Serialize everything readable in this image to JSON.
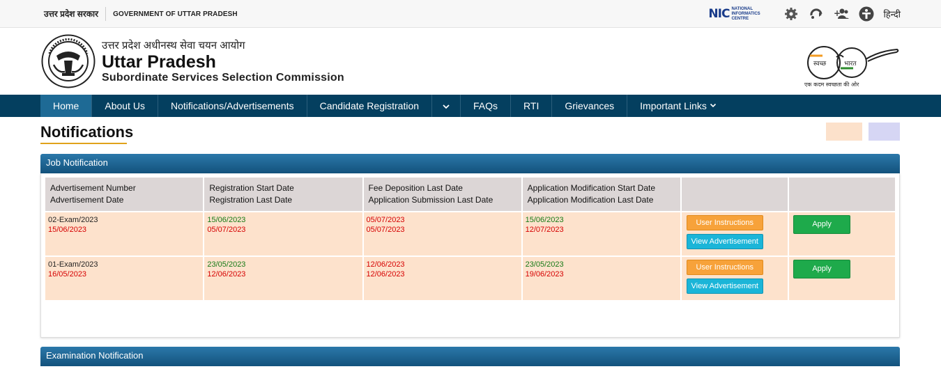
{
  "topbar": {
    "gov_hindi": "उत्तर प्रदेश सरकार",
    "gov_english": "GOVERNMENT OF UTTAR PRADESH",
    "nic_mark": "NIC",
    "nic_text": "NATIONAL INFORMATICS CENTRE",
    "language": "हिन्दी"
  },
  "header": {
    "title_hindi": "उत्तर प्रदेश अधीनस्थ सेवा चयन आयोग",
    "title_main": "Uttar Pradesh",
    "title_sub": "Subordinate Services Selection Commission",
    "swachh_left": "स्वच्छ",
    "swachh_right": "भारत",
    "swachh_tagline": "एक कदम स्वच्छता की ओर"
  },
  "nav": {
    "items": [
      {
        "label": "Home",
        "active": true
      },
      {
        "label": "About Us"
      },
      {
        "label": "Notifications/Advertisements"
      },
      {
        "label": "Candidate Registration"
      },
      {
        "label": ""
      },
      {
        "label": "FAQs"
      },
      {
        "label": "RTI"
      },
      {
        "label": "Grievances"
      },
      {
        "label": "Important Links"
      }
    ]
  },
  "page": {
    "title": "Notifications"
  },
  "job_panel": {
    "title": "Job Notification",
    "headers": [
      [
        "Advertisement Number",
        "Advertisement Date"
      ],
      [
        "Registration Start Date",
        "Registration Last Date"
      ],
      [
        "Fee Deposition Last Date",
        "Application Submission Last Date"
      ],
      [
        "Application Modification Start Date",
        "Application Modification Last Date"
      ],
      [
        "",
        ""
      ],
      [
        "",
        ""
      ]
    ],
    "rows": [
      {
        "adv_number": "02-Exam/2023",
        "adv_date": "15/06/2023",
        "reg_start": "15/06/2023",
        "reg_last": "05/07/2023",
        "fee_last": "05/07/2023",
        "sub_last": "05/07/2023",
        "mod_start": "15/06/2023",
        "mod_last": "12/07/2023",
        "user_instructions": "User Instructions",
        "view_advertisement": "View Advertisement",
        "apply": "Apply"
      },
      {
        "adv_number": "01-Exam/2023",
        "adv_date": "16/05/2023",
        "reg_start": "23/05/2023",
        "reg_last": "12/06/2023",
        "fee_last": "12/06/2023",
        "sub_last": "12/06/2023",
        "mod_start": "23/05/2023",
        "mod_last": "19/06/2023",
        "user_instructions": "User Instructions",
        "view_advertisement": "View Advertisement",
        "apply": "Apply"
      }
    ]
  },
  "exam_panel": {
    "title": "Examination Notification"
  },
  "colors": {
    "nav_bg": "#043f5f",
    "nav_active": "#1e6a95",
    "row_bg": "#fde2cc",
    "header_cell_bg": "#dcd6d6",
    "accent_underline": "#e0a21b",
    "swatch_peach": "#fce1cb",
    "swatch_lavender": "#d6d6f4"
  }
}
